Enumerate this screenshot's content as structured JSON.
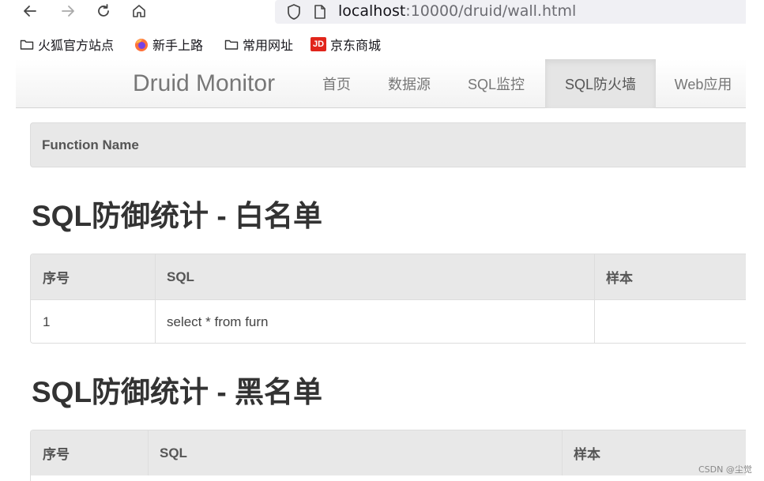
{
  "browser": {
    "url_host": "localhost",
    "url_rest": ":10000/druid/wall.html",
    "bookmarks": [
      {
        "label": "火狐官方站点",
        "icon": "folder-icon"
      },
      {
        "label": "新手上路",
        "icon": "firefox-icon"
      },
      {
        "label": "常用网址",
        "icon": "folder-icon"
      },
      {
        "label": "京东商城",
        "icon": "jd-logo-icon"
      }
    ],
    "jd_logo_text": "JD"
  },
  "app": {
    "brand": "Druid Monitor",
    "nav": [
      {
        "label": "首页"
      },
      {
        "label": "数据源"
      },
      {
        "label": "SQL监控"
      },
      {
        "label": "SQL防火墙",
        "active": true
      },
      {
        "label": "Web应用"
      }
    ]
  },
  "function_bar": {
    "label": "Function Name"
  },
  "whitelist": {
    "title": "SQL防御统计 - 白名单",
    "headers": [
      "序号",
      "SQL",
      "样本"
    ],
    "rows": [
      {
        "index": "1",
        "sql": "select * from furn",
        "sample": ""
      }
    ]
  },
  "blacklist": {
    "title": "SQL防御统计 - 黑名单",
    "headers": [
      "序号",
      "SQL",
      "样本"
    ]
  },
  "watermark": "CSDN @尘觉",
  "colors": {
    "navbar_active": "#e5e5e5",
    "table_head": "#e8e8e8",
    "jd_red": "#e1251b"
  }
}
